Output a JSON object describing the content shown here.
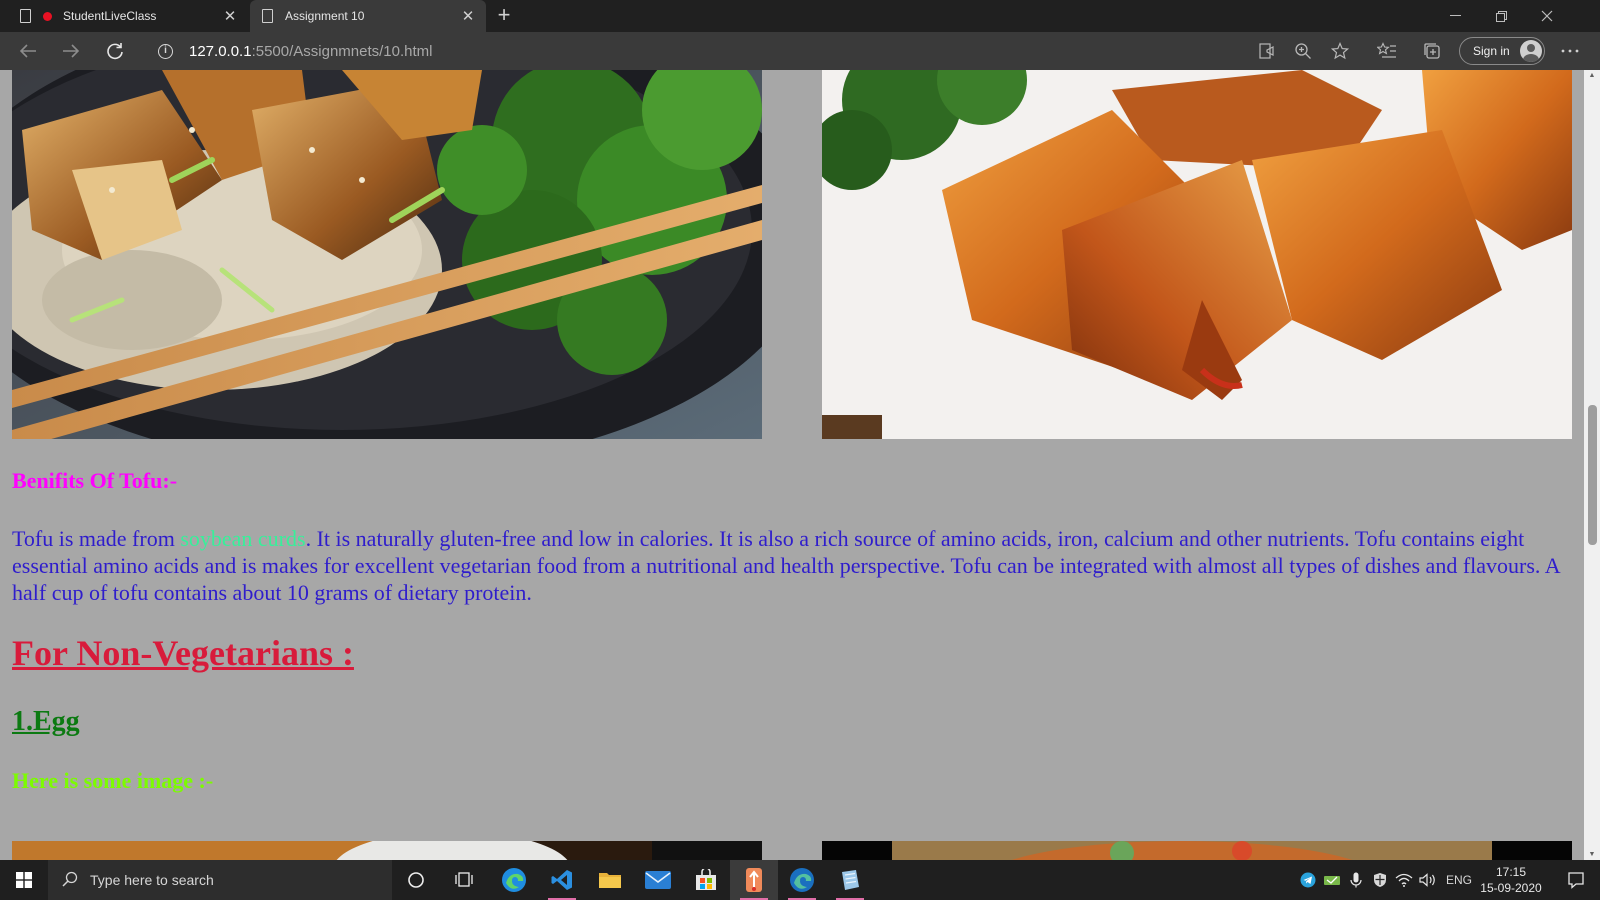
{
  "browser": {
    "tabs": [
      {
        "title": "StudentLiveClass",
        "recording": true,
        "active": false
      },
      {
        "title": "Assignment 10",
        "active": true
      }
    ],
    "url": {
      "host": "127.0.0.1",
      "rest": ":5500/Assignmnets/10.html"
    },
    "sign_in_label": "Sign in",
    "icons": [
      "back-icon",
      "forward-icon",
      "refresh-icon",
      "info-icon",
      "read-aloud-icon",
      "zoom-icon",
      "favorite-star-icon",
      "favorites-icon",
      "collections-icon",
      "more-icon"
    ]
  },
  "page": {
    "benefits_heading": "Benifits Of Tofu:-",
    "paragraph": {
      "before": "Tofu is made from ",
      "highlight": "soybean curds",
      "after": ". It is naturally gluten-free and low in calories. It is also a rich source of amino acids, iron, calcium and other nutrients. Tofu contains eight essential amino acids and is makes for excellent vegetarian food from a nutritional and health perspective. Tofu can be integrated with almost all types of dishes and flavours. A half cup of tofu contains about 10 grams of dietary protein."
    },
    "nonveg_heading": "For Non-Vegetarians :",
    "egg_heading": "1.Egg",
    "image_caption": "Here is some image :-",
    "colors": {
      "background": "#a7a7a7",
      "benefits": "#ff00ff",
      "paragraph": "#2f1dcc",
      "highlight": "#37f09a",
      "nonveg": "#d81b3b",
      "egg": "#0c7a12",
      "caption": "#7cfc00"
    }
  },
  "taskbar": {
    "search_placeholder": "Type here to search",
    "language": "ENG",
    "time": "17:15",
    "date": "15-09-2020"
  }
}
